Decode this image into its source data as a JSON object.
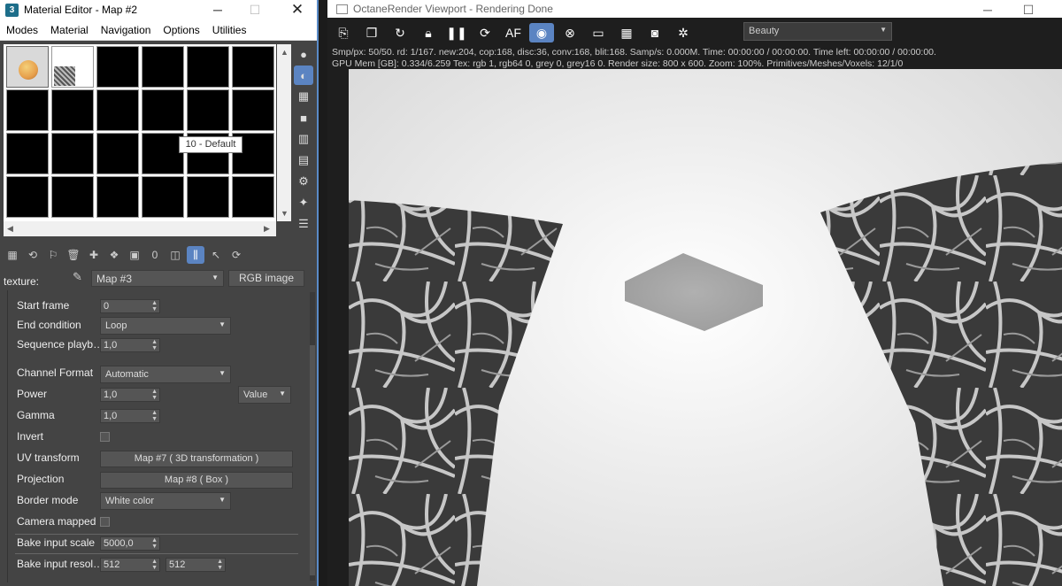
{
  "material_editor": {
    "title": "Material Editor - Map #2",
    "app_icon_text": "3",
    "menu": [
      "Modes",
      "Material",
      "Navigation",
      "Options",
      "Utilities"
    ],
    "tooltip": "10 - Default",
    "texture_label": "texture:",
    "map_dropdown": "Map #3",
    "rgb_button": "RGB image",
    "params": {
      "start_frame_label": "Start frame",
      "start_frame_value": "0",
      "end_condition_label": "End condition",
      "end_condition_value": "Loop",
      "sequence_label": "Sequence playb…",
      "sequence_value": "1,0",
      "channel_format_label": "Channel Format",
      "channel_format_value": "Automatic",
      "power_label": "Power",
      "power_value": "1,0",
      "power_mode": "Value",
      "gamma_label": "Gamma",
      "gamma_value": "1,0",
      "invert_label": "Invert",
      "uv_label": "UV transform",
      "uv_button": "Map #7  ( 3D transformation )",
      "projection_label": "Projection",
      "projection_button": "Map #8  ( Box )",
      "border_label": "Border mode",
      "border_value": "White color",
      "camera_label": "Camera mapped",
      "bake_scale_label": "Bake input scale",
      "bake_scale_value": "5000,0",
      "bake_res_label": "Bake input resol…",
      "bake_res_w": "512",
      "bake_res_h": "512"
    }
  },
  "viewport": {
    "title": "OctaneRender Viewport - Rendering Done",
    "pass_dropdown": "Beauty",
    "stats_line1": "Smp/px: 50/50.   rd: 1/167.   new:204, cop:168, disc:36, conv:168, blit:168.   Samp/s: 0.000M.   Time: 00:00:00 / 00:00:00.   Time left: 00:00:00 / 00:00:00.",
    "stats_line2": "GPU Mem [GB]: 0.334/6.259   Tex: rgb 1, rgb64 0, grey 0, grey16 0.   Render size: 800 x 600.   Zoom: 100%.   Primitives/Meshes/Voxels: 12/1/0"
  },
  "icons": {
    "minimize": "minimize-icon",
    "maximize": "maximize-icon",
    "close": "close-icon"
  },
  "accent_color": "#5b84c2"
}
